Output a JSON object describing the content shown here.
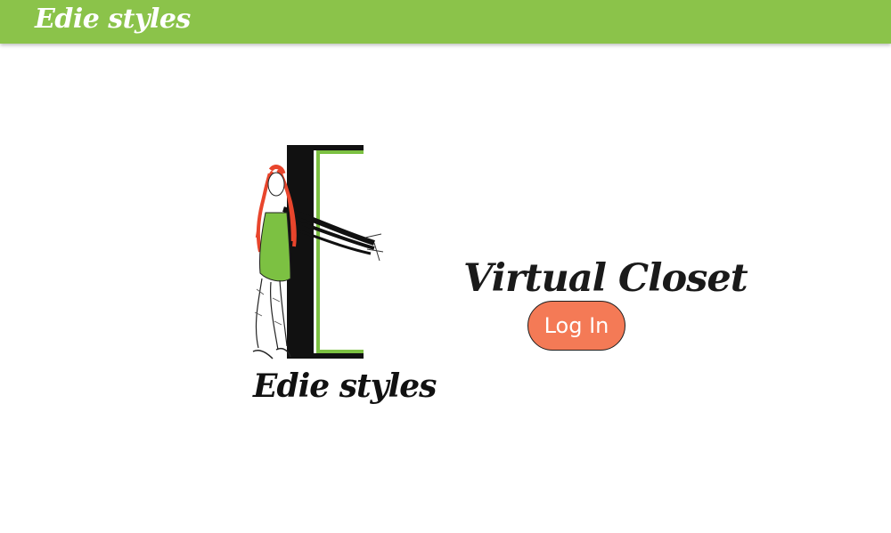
{
  "navbar": {
    "brand": "Edie styles"
  },
  "hero": {
    "logo_wordmark": "Edie styles",
    "headline": "Virtual Closet",
    "login_label": "Log In"
  },
  "colors": {
    "navbar_bg": "#8bc34a",
    "button_bg": "#f47a56",
    "logo_green": "#7cc142",
    "hair_red": "#e8452c"
  }
}
